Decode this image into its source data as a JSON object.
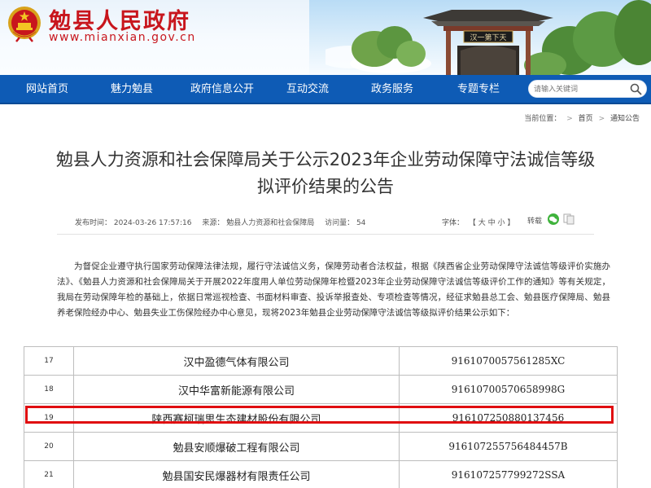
{
  "header": {
    "site_name": "勉县人民政府",
    "site_url": "www.mianxian.gov.cn",
    "gate_plaque": "汉一第下天"
  },
  "nav": {
    "items": [
      "网站首页",
      "魅力勉县",
      "政府信息公开",
      "互动交流",
      "政务服务",
      "专题专栏"
    ],
    "search_placeholder": "请输入关键词"
  },
  "breadcrumb": {
    "label": "当前位置：",
    "items": [
      "首页",
      "通知公告"
    ],
    "separator": ">"
  },
  "article": {
    "title": "勉县人力资源和社会保障局关于公示2023年企业劳动保障守法诚信等级拟评价结果的公告",
    "published": "发布时间：  2024-03-26 17:57:16",
    "source": "来源：  勉县人力资源和社会保障局",
    "views": "访问量：  54",
    "font_label": "字体：",
    "font_options": "【 大  中  小 】",
    "share_label": "转载",
    "body": "为督促企业遵守执行国家劳动保障法律法规，履行守法诚信义务，保障劳动者合法权益，根据《陕西省企业劳动保障守法诚信等级评价实施办法》、《勉县人力资源和社会保障局关于开展2022年度用人单位劳动保障年检暨2023年企业劳动保障守法诚信等级评价工作的通知》等有关规定，我局在劳动保障年检的基础上，依据日常巡视检查、书面材料审查、投诉举报查处、专项检查等情况，经征求勉县总工会、勉县医疗保障局、勉县养老保险经办中心、勉县失业工伤保险经办中心意见，现将2023年勉县企业劳动保障守法诚信等级拟评价结果公示如下："
  },
  "table": {
    "rows": [
      {
        "num": "17",
        "company": "汉中盈德气体有限公司",
        "code": "9161070057561285XC"
      },
      {
        "num": "18",
        "company": "汉中华富新能源有限公司",
        "code": "91610700570658998G"
      },
      {
        "num": "19",
        "company": "陕西赛柯瑞思生态建材股份有限公司",
        "code": "916107250880137456"
      },
      {
        "num": "20",
        "company": "勉县安顺爆破工程有限公司",
        "code": "916107255756484457B"
      },
      {
        "num": "21",
        "company": "勉县国安民爆器材有限责任公司",
        "code": "916107257799272SSA"
      }
    ],
    "highlighted_row": "19"
  },
  "colors": {
    "brand_red": "#c8161d",
    "nav_blue": "#0e5bb5",
    "highlight_red": "#e00d10"
  }
}
